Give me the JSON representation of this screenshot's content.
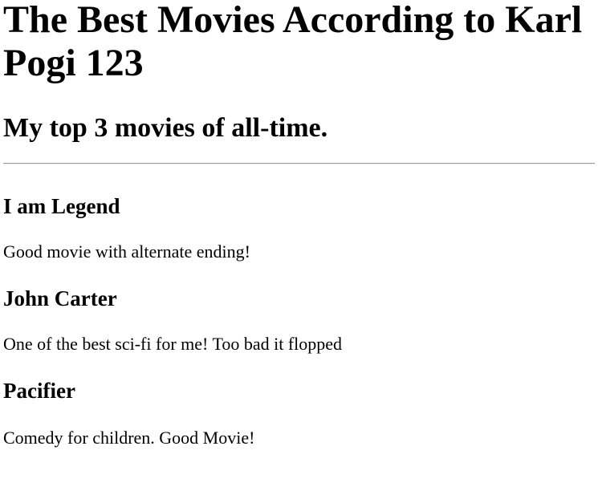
{
  "page": {
    "title": "The Best Movies According to Karl Pogi 123",
    "subtitle": "My top 3 movies of all-time."
  },
  "movies": [
    {
      "title": "I am Legend",
      "description": "Good movie with alternate ending!"
    },
    {
      "title": "John Carter",
      "description": "One of the best sci-fi for me! Too bad it flopped"
    },
    {
      "title": "Pacifier",
      "description": "Comedy for children. Good Movie!"
    }
  ]
}
